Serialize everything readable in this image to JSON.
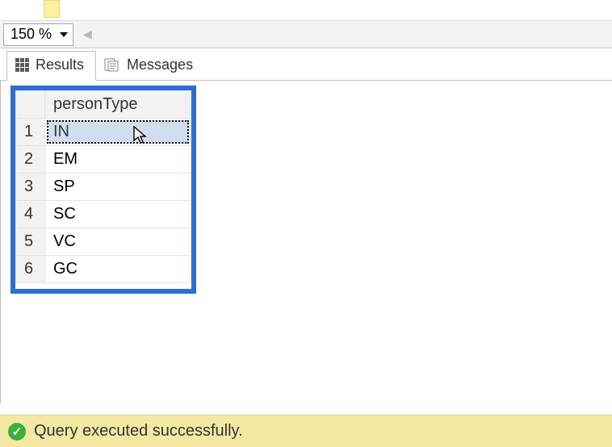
{
  "zoom": {
    "value": "150 %"
  },
  "tabs": {
    "results_label": "Results",
    "messages_label": "Messages"
  },
  "grid": {
    "column_header": "personType",
    "rows": [
      {
        "n": "1",
        "v": "IN"
      },
      {
        "n": "2",
        "v": "EM"
      },
      {
        "n": "3",
        "v": "SP"
      },
      {
        "n": "4",
        "v": "SC"
      },
      {
        "n": "5",
        "v": "VC"
      },
      {
        "n": "6",
        "v": "GC"
      }
    ]
  },
  "status": {
    "message": "Query executed successfully."
  }
}
